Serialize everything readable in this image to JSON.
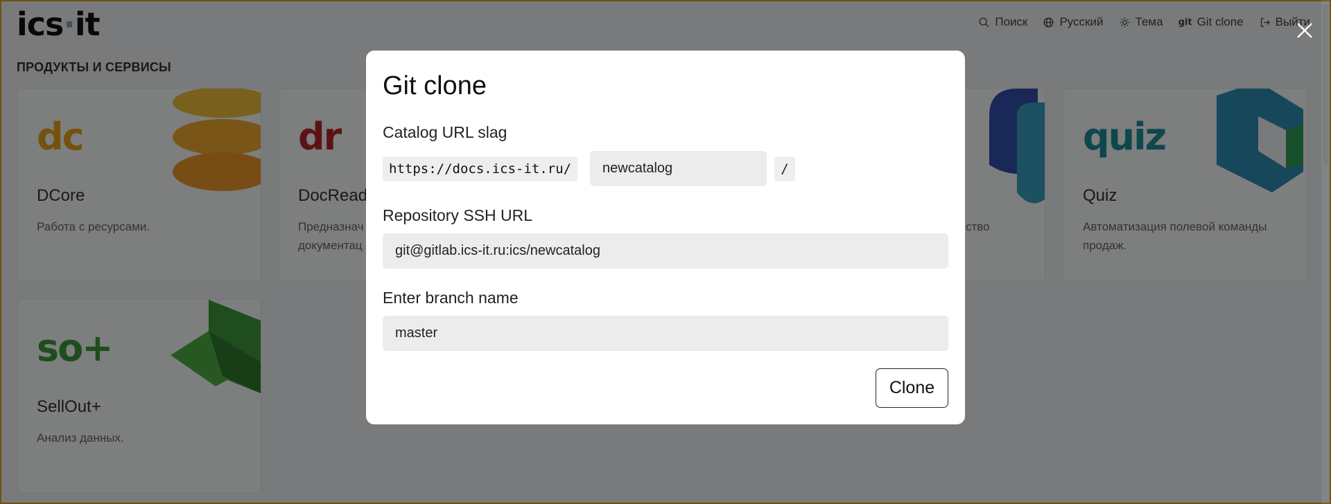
{
  "header": {
    "logo_text": "ics",
    "logo_dot": "·",
    "logo_suffix": "it",
    "nav": [
      {
        "label": "Поиск",
        "icon": "search-icon"
      },
      {
        "label": "Русский",
        "icon": "globe-icon"
      },
      {
        "label": "Тема",
        "icon": "sun-icon"
      },
      {
        "label": "Git clone",
        "icon": "git-icon",
        "glyph": "git"
      },
      {
        "label": "Выйти",
        "icon": "logout-icon"
      }
    ]
  },
  "section": {
    "title": "ПРОДУКТЫ И СЕРВИСЫ"
  },
  "cards": [
    {
      "mark": "dc",
      "name": "DCore",
      "desc": "Работа с ресурсами.",
      "color": "#e8a41a"
    },
    {
      "mark": "dr",
      "name": "DocRead",
      "desc": "Предназнач документац",
      "color": "#b8242b"
    },
    {
      "mark": "",
      "name": "",
      "desc": "ство",
      "color": "#3b56b8"
    },
    {
      "mark": "quiz",
      "name": "Quiz",
      "desc": "Автоматизация полевой команды продаж.",
      "color": "#1f8f9a"
    },
    {
      "mark": "so+",
      "name": "SellOut+",
      "desc": "Анализ данных.",
      "color": "#3f9a3a"
    }
  ],
  "modal": {
    "title": "Git clone",
    "catalog_label": "Catalog URL slag",
    "catalog_prefix": "https://docs.ics-it.ru/",
    "catalog_value": "newcatalog",
    "catalog_suffix": "/",
    "repo_label": "Repository SSH URL",
    "repo_value": "git@gitlab.ics-it.ru:ics/newcatalog",
    "branch_label": "Enter branch name",
    "branch_value": "master",
    "clone_label": "Clone"
  },
  "colors": {
    "overlay": "rgba(0,0,0,0.5)",
    "frame": "#e3a51f"
  }
}
